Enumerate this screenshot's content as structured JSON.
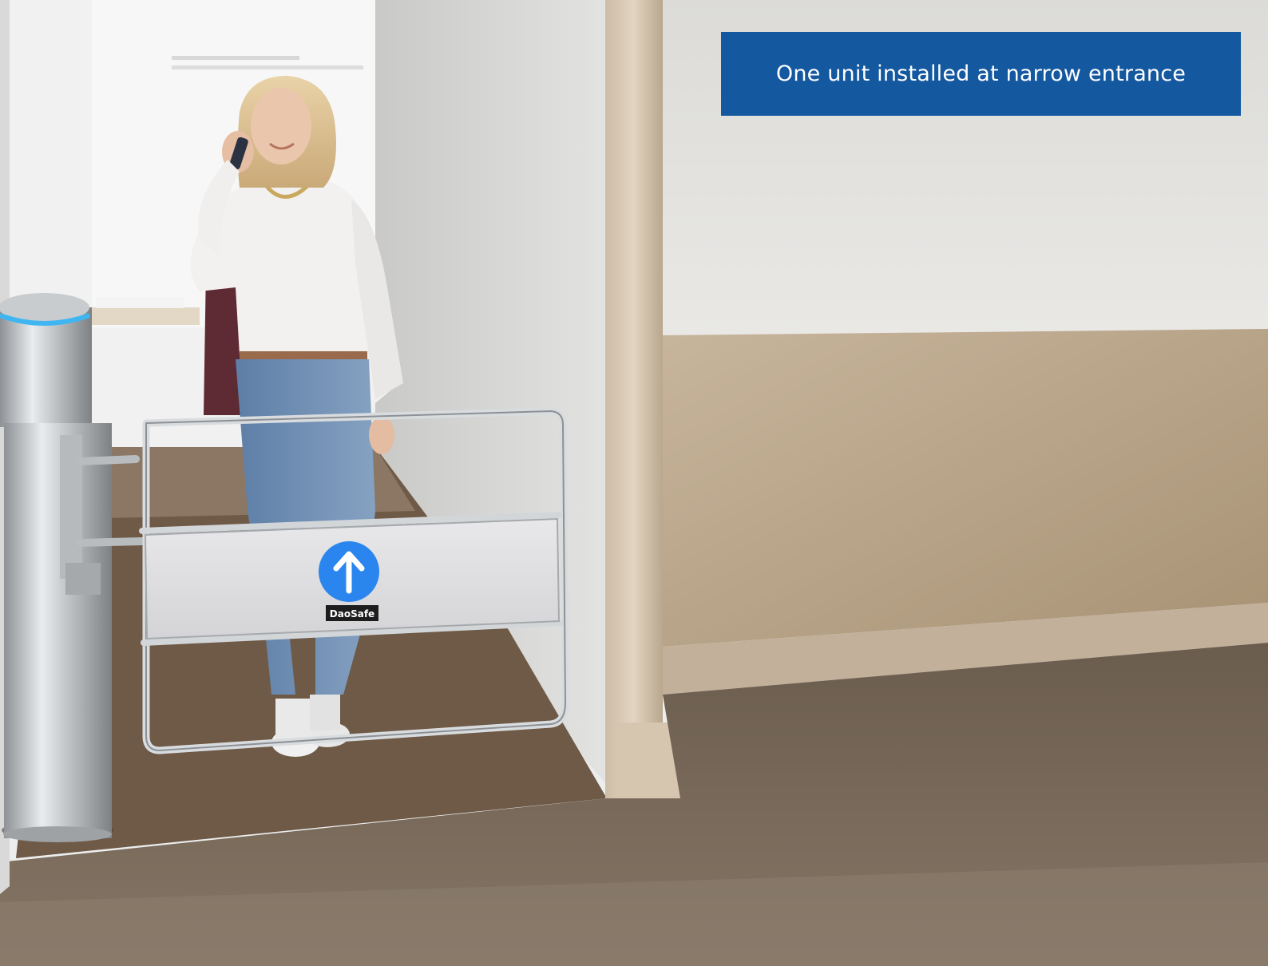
{
  "caption": {
    "text": "One unit installed at narrow entrance",
    "background": "#1458a0",
    "color": "#ffffff"
  },
  "gate_panel": {
    "brand_text": "DaoSafe",
    "arrow_icon": "arrow-up-icon",
    "arrow_color": "#2a86ee"
  },
  "turnstile_post": {
    "indicator_color": "#3fb6f2"
  }
}
